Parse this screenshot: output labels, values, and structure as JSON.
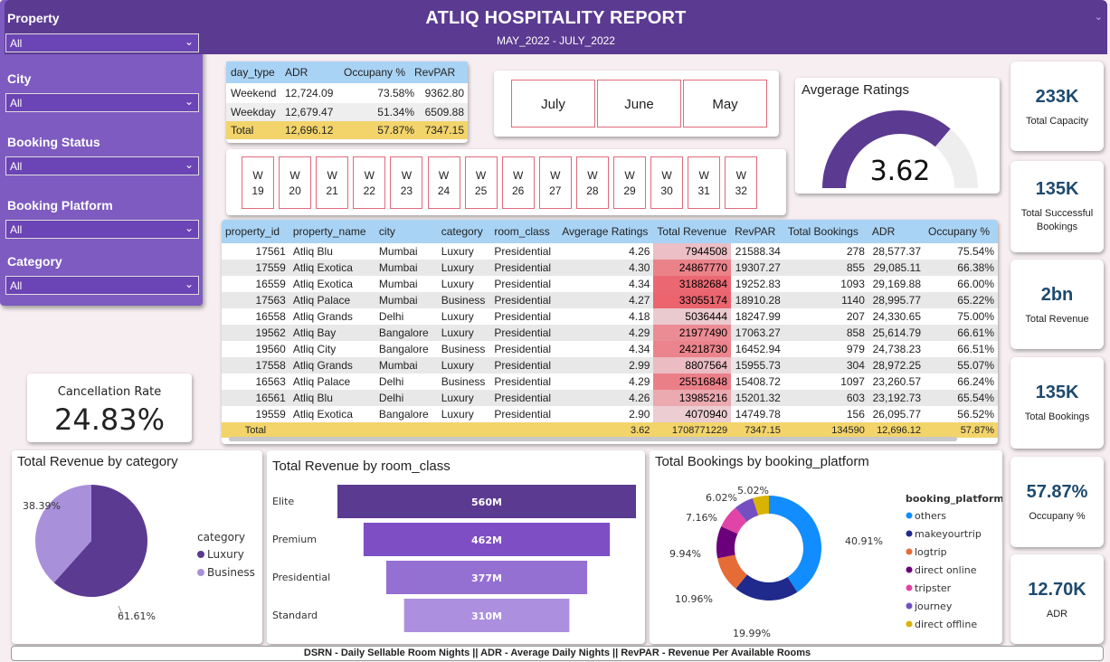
{
  "header": {
    "title": "ATLIQ HOSPITALITY REPORT",
    "subtitle": "MAY_2022 -  JULY_2022"
  },
  "filters": [
    {
      "label": "Property",
      "value": "All"
    },
    {
      "label": "City",
      "value": "All"
    },
    {
      "label": "Booking Status",
      "value": "All"
    },
    {
      "label": "Booking Platform",
      "value": "All"
    },
    {
      "label": "Category",
      "value": "All"
    }
  ],
  "cancellation": {
    "label": "Cancellation Rate",
    "value": "24.83%"
  },
  "day_table": {
    "headers": [
      "day_type",
      "ADR",
      "Occupany %",
      "RevPAR"
    ],
    "rows": [
      [
        "Weekend",
        "12,724.09",
        "73.58%",
        "9362.80"
      ],
      [
        "Weekday",
        "12,679.47",
        "51.34%",
        "6509.88"
      ]
    ],
    "total": [
      "Total",
      "12,696.12",
      "57.87%",
      "7347.15"
    ]
  },
  "months": [
    "July",
    "June",
    "May"
  ],
  "weeks": [
    "W 19",
    "W 20",
    "W 21",
    "W 22",
    "W 23",
    "W 24",
    "W 25",
    "W 26",
    "W 27",
    "W 28",
    "W 29",
    "W 30",
    "W 31",
    "W 32"
  ],
  "gauge": {
    "label": "Avgerage Ratings",
    "value": "3.62",
    "fraction": 0.724,
    "fill_color": "#5b3a91",
    "track_color": "#eeeeee"
  },
  "property_table": {
    "headers": [
      "property_id",
      "property_name",
      "city",
      "category",
      "room_class",
      "Avgerage Ratings",
      "Total Revenue",
      "RevPAR",
      "Total Bookings",
      "ADR",
      "Occupany %"
    ],
    "rows": [
      [
        "17561",
        "Atliq Blu",
        "Mumbai",
        "Luxury",
        "Presidential",
        "4.26",
        "7944508",
        "21588.34",
        "278",
        "28,577.37",
        "75.54%"
      ],
      [
        "17559",
        "Atliq Exotica",
        "Mumbai",
        "Luxury",
        "Presidential",
        "4.30",
        "24867770",
        "19307.27",
        "855",
        "29,085.11",
        "66.38%"
      ],
      [
        "16559",
        "Atliq Exotica",
        "Mumbai",
        "Luxury",
        "Presidential",
        "4.34",
        "31882684",
        "19252.83",
        "1093",
        "29,169.88",
        "66.00%"
      ],
      [
        "17563",
        "Atliq Palace",
        "Mumbai",
        "Business",
        "Presidential",
        "4.27",
        "33055174",
        "18910.28",
        "1140",
        "28,995.77",
        "65.22%"
      ],
      [
        "16558",
        "Atliq Grands",
        "Delhi",
        "Luxury",
        "Presidential",
        "4.18",
        "5036444",
        "18247.99",
        "207",
        "24,330.65",
        "75.00%"
      ],
      [
        "19562",
        "Atliq Bay",
        "Bangalore",
        "Luxury",
        "Presidential",
        "4.29",
        "21977490",
        "17063.27",
        "858",
        "25,614.79",
        "66.61%"
      ],
      [
        "19560",
        "Atliq City",
        "Bangalore",
        "Business",
        "Presidential",
        "4.34",
        "24218730",
        "16452.94",
        "979",
        "24,738.23",
        "66.51%"
      ],
      [
        "17558",
        "Atliq Grands",
        "Mumbai",
        "Luxury",
        "Presidential",
        "2.99",
        "8807564",
        "15955.73",
        "304",
        "28,972.25",
        "55.07%"
      ],
      [
        "16563",
        "Atliq Palace",
        "Delhi",
        "Business",
        "Presidential",
        "4.29",
        "25516848",
        "15408.72",
        "1097",
        "23,260.57",
        "66.24%"
      ],
      [
        "16561",
        "Atliq Blu",
        "Delhi",
        "Luxury",
        "Presidential",
        "4.26",
        "13985216",
        "15201.32",
        "603",
        "23,192.73",
        "65.54%"
      ],
      [
        "19559",
        "Atliq Exotica",
        "Bangalore",
        "Luxury",
        "Presidential",
        "2.90",
        "4070940",
        "14749.78",
        "156",
        "26,095.77",
        "56.52%"
      ]
    ],
    "total": [
      "Total",
      "",
      "",
      "",
      "",
      "3.62",
      "1708771229",
      "7347.15",
      "134590",
      "12,696.12",
      "57.87%"
    ]
  },
  "kpis": [
    {
      "value": "233K",
      "label": "Total Capacity"
    },
    {
      "value": "135K",
      "label": "Total Successful Bookings"
    },
    {
      "value": "2bn",
      "label": "Total Revenue"
    },
    {
      "value": "135K",
      "label": "Total Bookings"
    },
    {
      "value": "57.87%",
      "label": "Occupany %"
    },
    {
      "value": "12.70K",
      "label": "ADR"
    }
  ],
  "chart_data": [
    {
      "type": "pie",
      "title": "Total Revenue by category",
      "legend_title": "category",
      "legend_position": "right",
      "slices": [
        {
          "name": "Luxury",
          "percent": 61.61,
          "label": "61.61%",
          "color": "#5b3a91"
        },
        {
          "name": "Business",
          "percent": 38.39,
          "label": "38.39%",
          "color": "#a990db"
        }
      ]
    },
    {
      "type": "bar",
      "subtype": "funnel",
      "title": "Total Revenue by room_class",
      "categories": [
        "Elite",
        "Premium",
        "Presidential",
        "Standard"
      ],
      "values": [
        560,
        462,
        377,
        310
      ],
      "value_labels": [
        "560M",
        "462M",
        "377M",
        "310M"
      ],
      "colors": [
        "#5b3a91",
        "#7e4fc4",
        "#9570d3",
        "#ad8fdf"
      ]
    },
    {
      "type": "pie",
      "subtype": "donut",
      "title": "Total Bookings by booking_platform",
      "legend_title": "booking_platform",
      "legend_position": "right",
      "slices": [
        {
          "name": "others",
          "percent": 40.91,
          "label": "40.91%",
          "color": "#118dff"
        },
        {
          "name": "makeyourtrip",
          "percent": 19.99,
          "label": "19.99%",
          "color": "#1f2a8c"
        },
        {
          "name": "logtrip",
          "percent": 10.96,
          "label": "10.96%",
          "color": "#e66c37"
        },
        {
          "name": "direct online",
          "percent": 9.94,
          "label": "9.94%",
          "color": "#6b007b"
        },
        {
          "name": "tripster",
          "percent": 7.16,
          "label": "7.16%",
          "color": "#e044a7"
        },
        {
          "name": "journey",
          "percent": 6.02,
          "label": "6.02%",
          "color": "#744ec2"
        },
        {
          "name": "direct offline",
          "percent": 5.02,
          "label": "5.02%",
          "color": "#d9b300"
        }
      ]
    }
  ],
  "footer": "DSRN - Daily Sellable Room Nights || ADR - Average Daily Nights || RevPAR - Revenue Per Available Rooms"
}
